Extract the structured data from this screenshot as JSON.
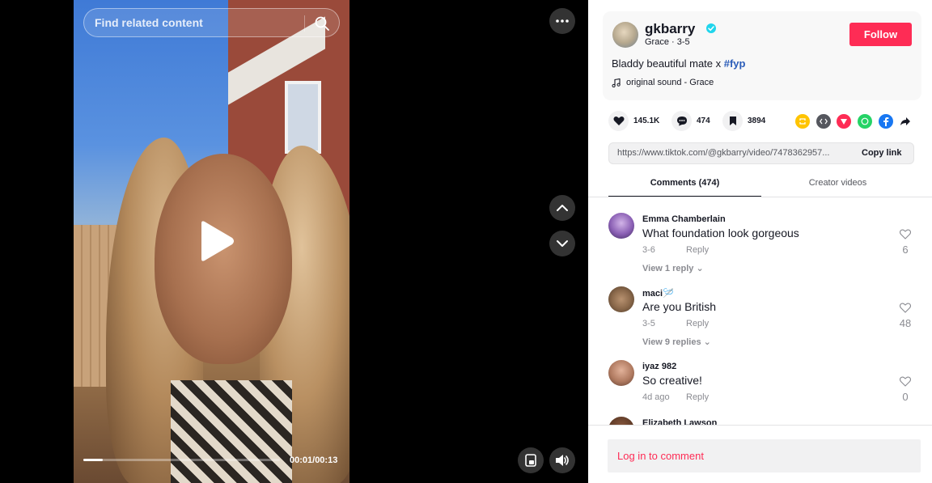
{
  "video": {
    "search_placeholder": "Find related content",
    "time": "00:01/00:13",
    "progress_fraction": 0.1
  },
  "author": {
    "username": "gkbarry",
    "display_name": "Grace",
    "date": "3-5",
    "meta": "Grace · 3-5",
    "follow_label": "Follow"
  },
  "post": {
    "caption_text": "Bladdy beautiful mate x ",
    "hashtag": "#fyp",
    "music": "original sound - Grace"
  },
  "stats": {
    "likes": "145.1K",
    "comments": "474",
    "saves": "3894"
  },
  "share": {
    "icons": [
      "repost-icon",
      "embed-icon",
      "send-icon",
      "whatsapp-icon",
      "facebook-icon",
      "share-arrow-icon"
    ],
    "colors": {
      "repost": "#ffc400",
      "embed": "#55575e",
      "send": "#fe2c55",
      "whatsapp": "#25d366",
      "facebook": "#1877f2"
    }
  },
  "link": {
    "url": "https://www.tiktok.com/@gkbarry/video/7478362957...",
    "copy_label": "Copy link"
  },
  "tabs": {
    "comments": "Comments (474)",
    "creator_videos": "Creator videos"
  },
  "comments": [
    {
      "user": "Emma Chamberlain",
      "text": "What foundation look gorgeous",
      "date": "3-6",
      "reply": "Reply",
      "view": "View 1 reply",
      "likes": "6"
    },
    {
      "user": "maci🪡",
      "text": "Are you British",
      "date": "3-5",
      "reply": "Reply",
      "view": "View 9 replies",
      "likes": "48"
    },
    {
      "user": "iyaz 982",
      "text": "So creative!",
      "date": "4d ago",
      "reply": "Reply",
      "view": "",
      "likes": "0"
    },
    {
      "user": "Elizabeth Lawson",
      "text": "",
      "date": "",
      "reply": "",
      "view": "",
      "likes": ""
    }
  ],
  "login_prompt": "Log in to comment",
  "accent_color": "#fe2c55"
}
